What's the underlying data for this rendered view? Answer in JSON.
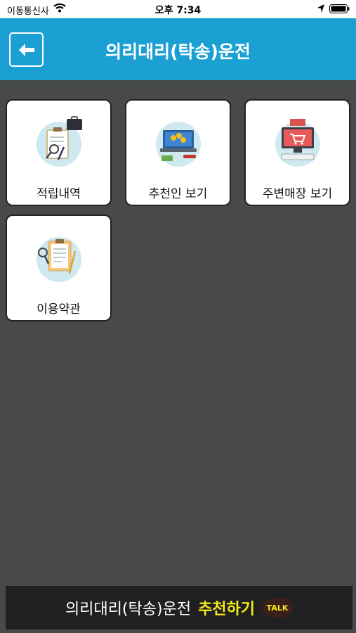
{
  "status_bar": {
    "carrier": "이동통신사",
    "time": "오후 7:34"
  },
  "header": {
    "title": "의리대리(탁송)운전"
  },
  "menu": {
    "items": [
      {
        "label": "적립내역",
        "icon": "clipboard-briefcase-icon"
      },
      {
        "label": "추천인 보기",
        "icon": "laptop-coins-icon"
      },
      {
        "label": "주변매장 보기",
        "icon": "online-shop-icon"
      },
      {
        "label": "이용약관",
        "icon": "document-magnifier-icon"
      }
    ]
  },
  "bottom_banner": {
    "name": "의리대리(탁송)운전",
    "cta": "추천하기",
    "badge": "TALK"
  },
  "colors": {
    "header": "#1aa0d3",
    "background": "#48494b",
    "banner": "#1f2022",
    "cta": "#f7ea12"
  }
}
